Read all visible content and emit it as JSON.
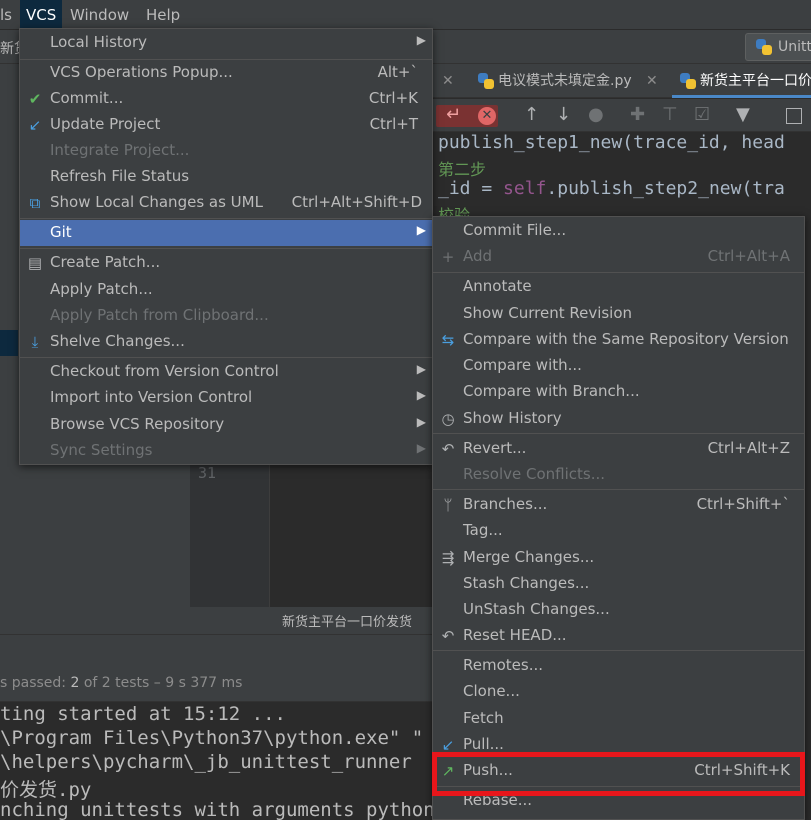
{
  "menubar": {
    "items": [
      {
        "label": "ls"
      },
      {
        "label": "VCS"
      },
      {
        "label": "Window"
      },
      {
        "label": "Help"
      }
    ]
  },
  "toolbar": {
    "left_text": "新货",
    "unit_label": "Unitt"
  },
  "tabs": [
    {
      "label": "电议模式未填定金.py"
    },
    {
      "label": "新货主平台一口价"
    }
  ],
  "code": {
    "lines": [
      {
        "pre": "publish_step1_new(trace_id, head",
        "self": ""
      },
      {
        "comment": "第二步"
      },
      {
        "pre": "_id = ",
        "self": "self",
        "post": ".publish_step2_new(tra"
      },
      {
        "comment": "校验"
      }
    ]
  },
  "vcs_menu": {
    "items": [
      {
        "label": "Local History",
        "shortcut": "",
        "submenu": true
      },
      {
        "label": "VCS Operations Popup...",
        "shortcut": "Alt+`"
      },
      {
        "label": "Commit...",
        "shortcut": "Ctrl+K",
        "icon": "✔"
      },
      {
        "label": "Update Project",
        "shortcut": "Ctrl+T",
        "icon": "↙"
      },
      {
        "label": "Integrate Project...",
        "disabled": true
      },
      {
        "label": "Refresh File Status"
      },
      {
        "label": "Show Local Changes as UML",
        "shortcut": "Ctrl+Alt+Shift+D",
        "icon": "⧉"
      },
      {
        "label": "Git",
        "submenu": true,
        "selected": true
      },
      {
        "label": "Create Patch...",
        "icon": "▤"
      },
      {
        "label": "Apply Patch..."
      },
      {
        "label": "Apply Patch from Clipboard...",
        "disabled": true
      },
      {
        "label": "Shelve Changes...",
        "icon": "⤓"
      },
      {
        "label": "Checkout from Version Control",
        "submenu": true
      },
      {
        "label": "Import into Version Control",
        "submenu": true
      },
      {
        "label": "Browse VCS Repository",
        "submenu": true
      },
      {
        "label": "Sync Settings",
        "submenu": true,
        "disabled": true
      }
    ]
  },
  "git_menu": {
    "items": [
      {
        "label": "Commit File..."
      },
      {
        "label": "Add",
        "shortcut": "Ctrl+Alt+A",
        "disabled": true,
        "icon": "+"
      },
      {
        "label": "Annotate"
      },
      {
        "label": "Show Current Revision"
      },
      {
        "label": "Compare with the Same Repository Version",
        "icon": "⇆"
      },
      {
        "label": "Compare with..."
      },
      {
        "label": "Compare with Branch..."
      },
      {
        "label": "Show History",
        "icon": "◷"
      },
      {
        "label": "Revert...",
        "shortcut": "Ctrl+Alt+Z",
        "icon": "↶"
      },
      {
        "label": "Resolve Conflicts...",
        "disabled": true
      },
      {
        "label": "Branches...",
        "shortcut": "Ctrl+Shift+`",
        "icon": "ᛘ"
      },
      {
        "label": "Tag..."
      },
      {
        "label": "Merge Changes...",
        "icon": "⇶"
      },
      {
        "label": "Stash Changes..."
      },
      {
        "label": "UnStash Changes..."
      },
      {
        "label": "Reset HEAD...",
        "icon": "↶"
      },
      {
        "label": "Remotes..."
      },
      {
        "label": "Clone..."
      },
      {
        "label": "Fetch"
      },
      {
        "label": "Pull...",
        "icon": "↙"
      },
      {
        "label": "Push...",
        "shortcut": "Ctrl+Shift+K",
        "icon": "↗"
      },
      {
        "label": "Rebase..."
      }
    ]
  },
  "editor": {
    "line_number": "31",
    "bottom_tab": "新货主平台一口价发货"
  },
  "test_status": {
    "prefix": "s passed: ",
    "count": "2",
    "of": " of 2 tests",
    "time": " – 9 s 377 ms"
  },
  "console": {
    "lines": [
      "ting started at 15:12 ...",
      "\\Program Files\\Python37\\python.exe\" \"",
      "\\helpers\\pycharm\\_jb_unittest_runner",
      "价发货.py",
      "nching unittests with arguments python"
    ]
  },
  "colors": {
    "menu_bg": "#3c3f41",
    "selection": "#4b6eaf",
    "highlight_box": "#e8161b",
    "editor_bg": "#2b2b2b"
  }
}
